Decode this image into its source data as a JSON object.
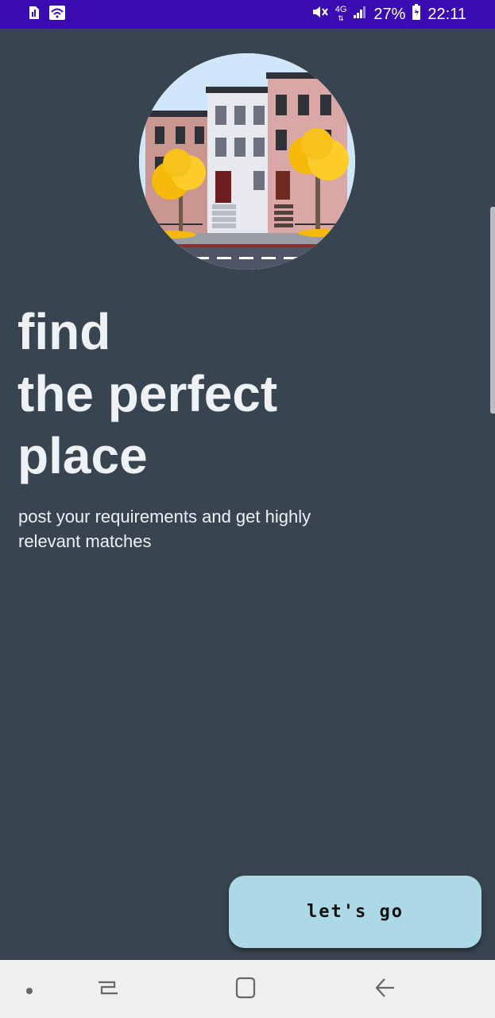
{
  "status_bar": {
    "battery_percent": "27%",
    "time": "22:11",
    "network": "4G"
  },
  "hero": {
    "icon": "townhouses-illustration"
  },
  "headline": {
    "lines": [
      "find",
      "the perfect",
      "place"
    ]
  },
  "subtitle": "post your requirements and get highly relevant matches",
  "cta": {
    "label": "let's go"
  },
  "navigation": {
    "icons": [
      "dot-icon",
      "recent-apps-icon",
      "home-icon",
      "back-icon"
    ]
  },
  "colors": {
    "status_bar": "#3a0bb0",
    "background": "#38444f",
    "button": "#add8e6"
  }
}
